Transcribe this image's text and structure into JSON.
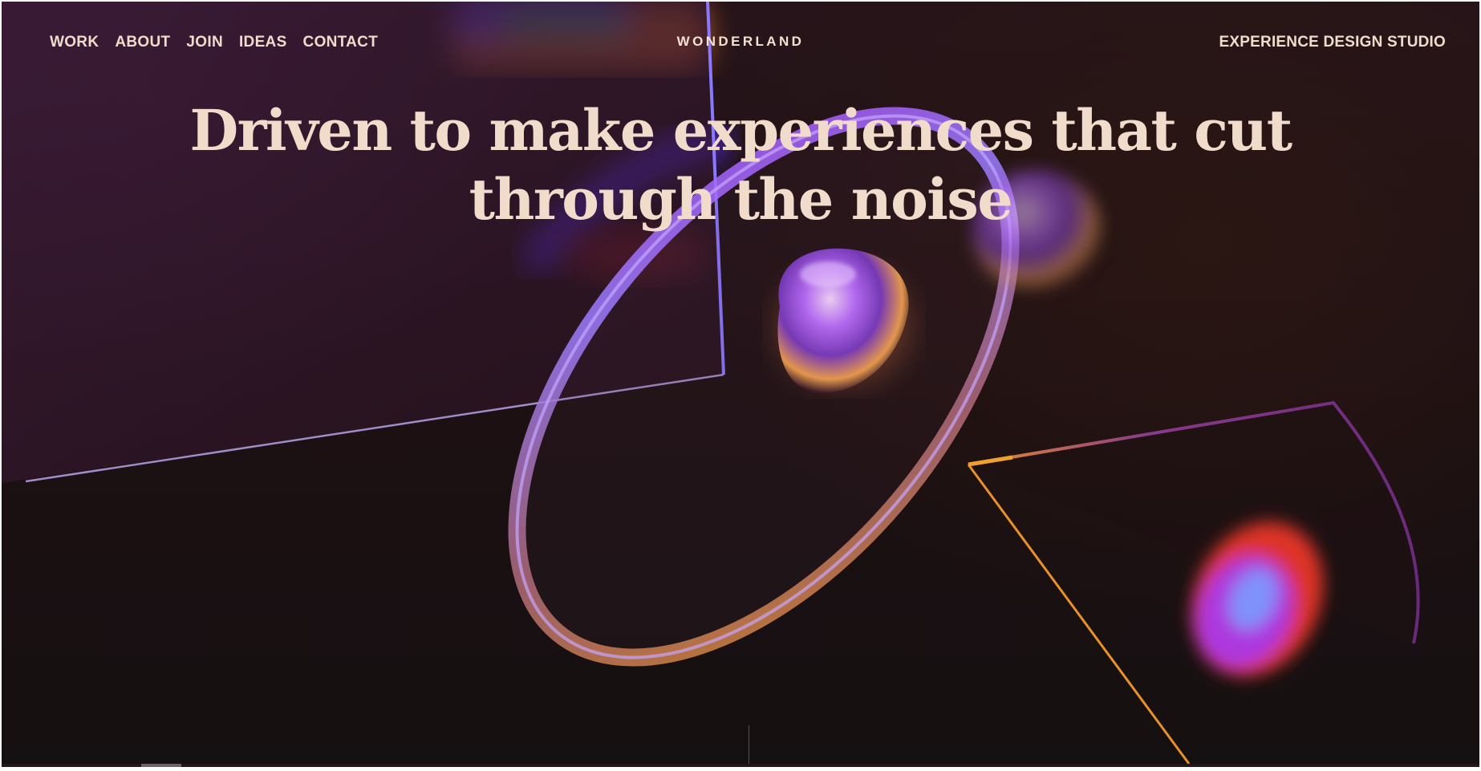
{
  "nav": {
    "items": [
      {
        "label": "WORK"
      },
      {
        "label": "ABOUT"
      },
      {
        "label": "JOIN"
      },
      {
        "label": "IDEAS"
      },
      {
        "label": "CONTACT"
      }
    ]
  },
  "brand": "WONDERLAND",
  "tagline": "EXPERIENCE DESIGN STUDIO",
  "hero": {
    "headline_line1": "Driven to make experiences that cut",
    "headline_line2": "through the noise"
  },
  "colors": {
    "text": "#f1dccb",
    "accent_purple": "#a240ff",
    "accent_orange": "#e0902a",
    "background": "#1c1012"
  }
}
